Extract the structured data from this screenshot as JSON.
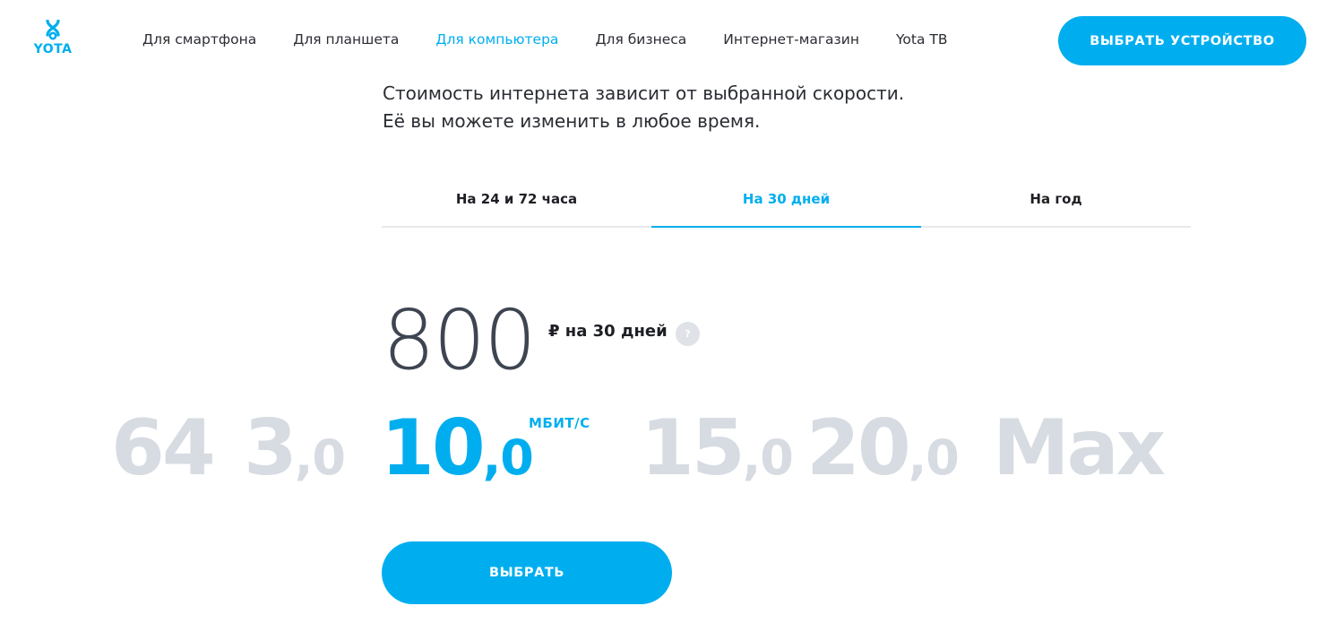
{
  "header": {
    "logo_text": "YOTA",
    "nav": [
      {
        "label": "Для смартфона",
        "active": false
      },
      {
        "label": "Для планшета",
        "active": false
      },
      {
        "label": "Для компьютера",
        "active": true
      },
      {
        "label": "Для бизнеса",
        "active": false
      },
      {
        "label": "Интернет-магазин",
        "active": false
      },
      {
        "label": "Yota ТВ",
        "active": false
      }
    ],
    "cta_label": "ВЫБРАТЬ УСТРОЙСТВО"
  },
  "description": {
    "line1": "Стоимость интернета зависит от выбранной скорости.",
    "line2": "Её вы можете изменить в любое время."
  },
  "tabs": [
    {
      "label": "На 24 и 72 часа",
      "active": false
    },
    {
      "label": "На 30 дней",
      "active": true
    },
    {
      "label": "На год",
      "active": false
    }
  ],
  "price": {
    "amount": "800",
    "period": "₽ на 30 дней",
    "help_icon": "question-icon",
    "help_glyph": "?"
  },
  "speeds": {
    "unit": "МБИТ/С",
    "options": [
      {
        "big": "64",
        "small": "",
        "active": false
      },
      {
        "big": "3",
        "small": ",0",
        "active": false
      },
      {
        "big": "10",
        "small": ",0",
        "active": true
      },
      {
        "big": "15",
        "small": ",0",
        "active": false
      },
      {
        "big": "20",
        "small": ",0",
        "active": false
      },
      {
        "big": "Max",
        "small": "",
        "active": false
      }
    ]
  },
  "select_label": "ВЫБРАТЬ",
  "colors": {
    "accent": "#00aeef",
    "inactive_speed": "#d7dbe2",
    "price_text": "#3e4552"
  }
}
